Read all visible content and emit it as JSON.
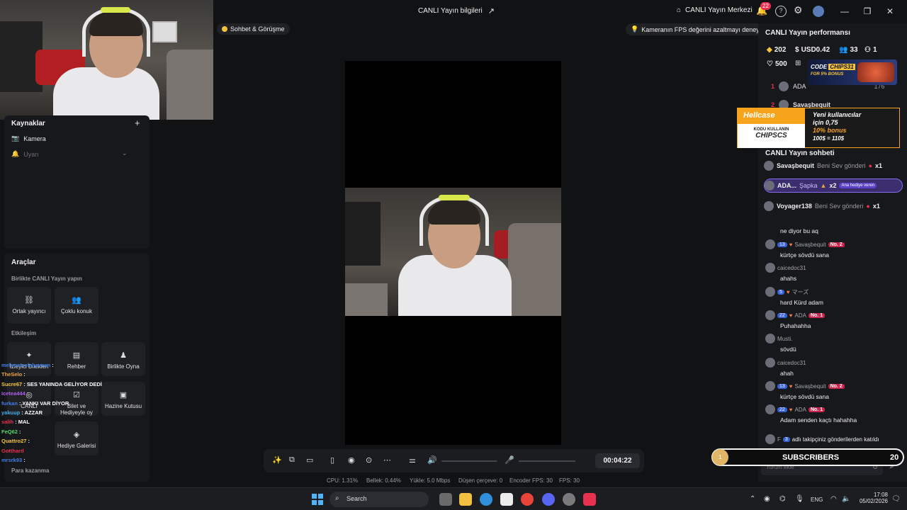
{
  "topbar": {
    "live_info_title": "CANLI Yayın bilgileri",
    "center_label": "CANLI Yayın Merkezi",
    "notif_count": "22"
  },
  "left": {
    "sources_title": "Kaynaklar",
    "camera_label": "Kamera",
    "alert_label": "Uyarı",
    "tools_title": "Araçlar",
    "collab_title": "Birlikte CANLI Yayın yapın",
    "co_host": "Ortak yayıncı",
    "multi_guest": "Çoklu konuk",
    "interaction_title": "Etkileşim",
    "wishes": "İzleyici Dilekleri",
    "guide": "Rehber",
    "play_together": "Birlikte Oyna",
    "canli": "CANLI",
    "ticket": "Bilet ve Hediyeyle oy",
    "treasure": "Hazine Kutusu",
    "gift_gallery": "Hediye Galerisi",
    "earn_title": "Para kazanma"
  },
  "overlay_chat": [
    {
      "user": "mehmetcelalyaman",
      "msg": ":",
      "color": "#3f7fe8"
    },
    {
      "user": "TheSelo",
      "msg": ":",
      "color": "#e8a23f"
    },
    {
      "user": "Sucre67",
      "msg": ": SES YANINDA GELİYOR DEDİ",
      "color": "#f5c33b"
    },
    {
      "user": "Icetea444",
      "msg": ":",
      "color": "#b05cf0"
    },
    {
      "user": "furkan",
      "msg": ": YANKI VAR DİYOR",
      "color": "#3f7fe8"
    },
    {
      "user": "yakuup",
      "msg": ": AZZAR",
      "color": "#3fb0e8"
    },
    {
      "user": "salih",
      "msg": ": MAL",
      "color": "#e8304f"
    },
    {
      "user": "FeQ62",
      "msg": ":",
      "color": "#4fd86a"
    },
    {
      "user": "Quattro27",
      "msg": ":",
      "color": "#f5c33b"
    },
    {
      "user": "Gotthard",
      "msg": "",
      "color": "#e8304f"
    },
    {
      "user": "mrsrk93",
      "msg": ":",
      "color": "#3f7fe8"
    }
  ],
  "center": {
    "chip_chat": "Sohbet & Görüşme",
    "chip_tip": "Kameranın FPS değerini azaltmayı deneyin",
    "timer": "00:04:22"
  },
  "stats_bar": {
    "cpu": "CPU: 1.31%",
    "mem": "Bellek: 0.44%",
    "upload": "Yükle: 5.0 Mbps",
    "dropped": "Düşen çerçeve: 0",
    "encoder": "Encoder FPS: 30",
    "fps": "FPS: 30"
  },
  "right": {
    "perf_title": "CANLI Yayın performansı",
    "coins": "202",
    "usd": "USD0.42",
    "viewers": "33",
    "followers": "1",
    "likes": "500",
    "rank1_name": "ADA",
    "rank1_val": "176",
    "rank2_name": "Savaşbequit",
    "chat_title": "CANLI Yayın sohbeti",
    "gifts": [
      {
        "name": "Savaşbequit",
        "action": "Beni Sev gönderi",
        "count": "x1"
      },
      {
        "name": "ADA...",
        "action": "Şapka",
        "count": "x2",
        "tag": "Ana hediye veren"
      },
      {
        "name": "Voyager138",
        "action": "Beni Sev gönderi",
        "count": "x1"
      }
    ],
    "messages": [
      {
        "user": "",
        "level": "",
        "text": "ne diyor bu aq"
      },
      {
        "user": "Savaşbequit",
        "level": "13",
        "badge": "No. 2",
        "text": "kürtçe sövdü sana"
      },
      {
        "user": "caicedoc31",
        "level": "",
        "text": "ahahs"
      },
      {
        "user": "マーズ",
        "level": "5",
        "text": "hard Kürd adam"
      },
      {
        "user": "ADA",
        "level": "22",
        "badge": "No. 1",
        "text": "Puhahahha"
      },
      {
        "user": "Musti.",
        "level": "",
        "text": "sövdü"
      },
      {
        "user": "caicedoc31",
        "level": "",
        "text": "ahah"
      },
      {
        "user": "Savaşbequit",
        "level": "13",
        "badge": "No. 2",
        "text": "kürtçe sövdü sana"
      },
      {
        "user": "ADA",
        "level": "22",
        "badge": "No. 1",
        "text": "Adam senden kaçtı hahahha"
      }
    ],
    "follow_msg": "adlı takipçiniz gönderilerden katıldı",
    "follow_user": "F",
    "follow_level": "3",
    "comment_placeholder": "Yorum ekle"
  },
  "ads": {
    "code_title": "CODE",
    "code_value": "CHIPS31",
    "code_bonus": "FOR 5% BONUS",
    "hellcase": "Hellcase",
    "hc_code_label": "KODU KULLANIN",
    "hc_code": "CHIPSCS",
    "hc_line1": "Yeni kullanıcılar",
    "hc_line2": "için 0,75",
    "hc_line3": "10% bonus",
    "hc_line4": "100$ = 110$"
  },
  "subs": {
    "label": "SUBSCRIBERS",
    "start": "1",
    "goal": "20"
  },
  "taskbar": {
    "search": "Search",
    "lang": "ENG",
    "time": "17:08",
    "date": "05/02/2026"
  }
}
